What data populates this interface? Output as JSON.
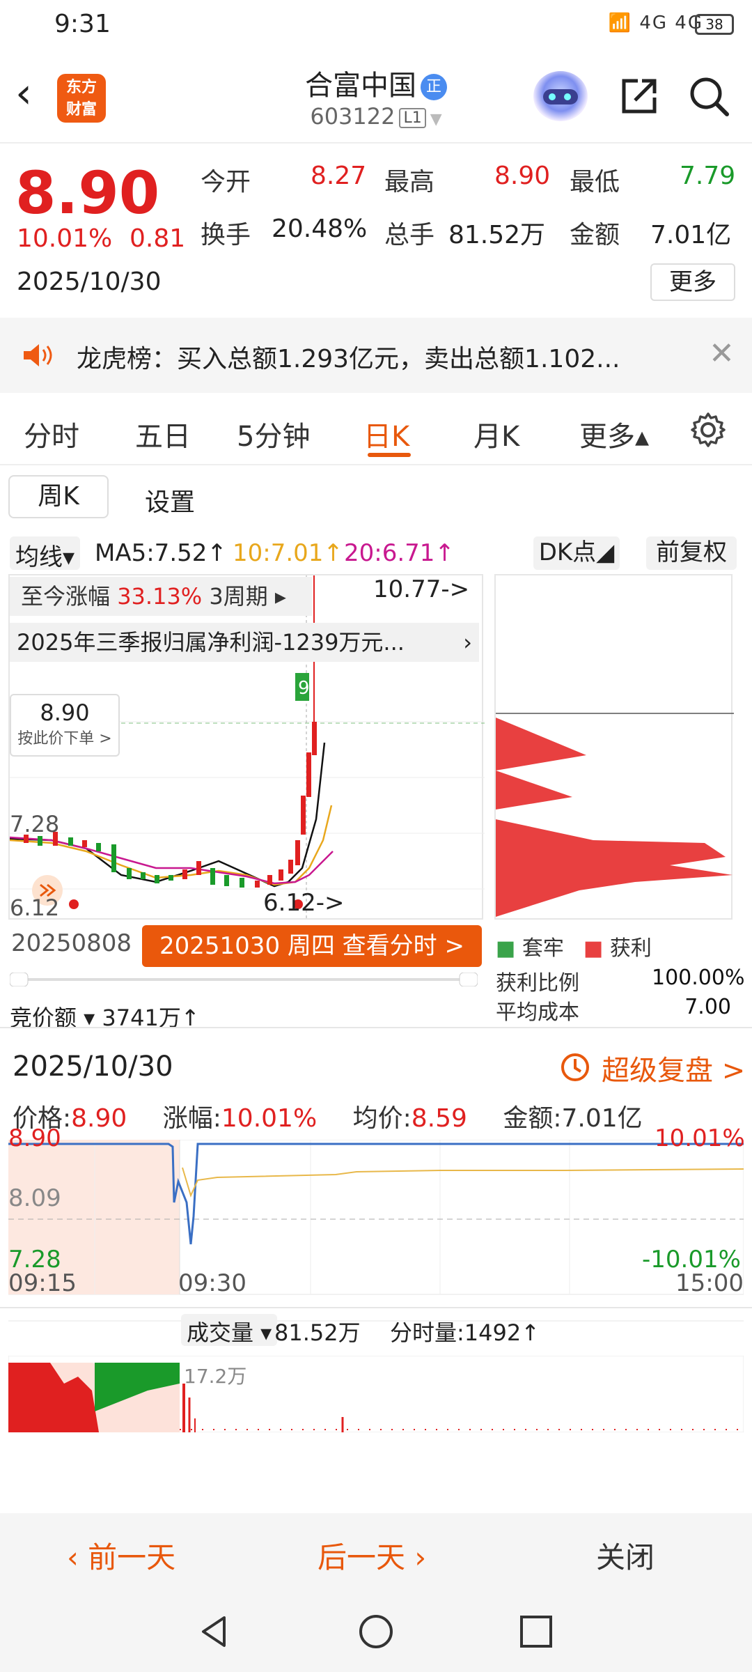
{
  "status": {
    "time": "9:31",
    "signal_icons": "📶 4G 4G",
    "battery": "38"
  },
  "header": {
    "back_icon": "‹",
    "logo_text": "东方\n财富",
    "stock_name": "合富中国",
    "corp_badge": "正",
    "code": "603122",
    "level": "L1"
  },
  "quote": {
    "price": "8.90",
    "change_pct": "10.01%",
    "change_amt": "0.81",
    "date": "2025/10/30",
    "open_label": "今开",
    "open": "8.27",
    "high_label": "最高",
    "high": "8.90",
    "low_label": "最低",
    "low": "7.79",
    "turnover_label": "换手",
    "turnover": "20.48%",
    "volume_label": "总手",
    "volume": "81.52万",
    "amount_label": "金额",
    "amount": "7.01亿",
    "more": "更多"
  },
  "news": {
    "text": "龙虎榜：买入总额1.293亿元，卖出总额1.102..."
  },
  "tabs": [
    "分时",
    "五日",
    "5分钟",
    "日K",
    "月K",
    "更多▴"
  ],
  "active_tab": "日K",
  "subtabs": {
    "week": "周K",
    "settings": "设置"
  },
  "ma": {
    "selector": "均线▾",
    "ma5": "MA5:7.52↑",
    "ma10": "10:7.01↑",
    "ma20": "20:6.71↑"
  },
  "buttons": {
    "dk": "DK点◢",
    "fq": "前复权"
  },
  "kline": {
    "gain_label": "至今涨幅",
    "gain_value": "33.13%",
    "gain_period": "3周期 ▸",
    "report": "2025年三季报归属净利润-1239万元...",
    "high_marker": "10.77->",
    "price_tag_value": "8.90",
    "price_tag_action": "按此价下单 >",
    "level_high": "7.28",
    "level_low": "6.12",
    "low_marker": "6.12->",
    "start_date": "20250808",
    "cta": "20251030 周四 查看分时 >",
    "vol_label": "竞价额 ▾ 3741万↑"
  },
  "chips": {
    "trap_label": "套牢",
    "profit_label": "获利",
    "profit_ratio_label": "获利比例",
    "profit_ratio": "100.00%",
    "avg_cost_label": "平均成本",
    "avg_cost": "7.00"
  },
  "sheet": {
    "date": "2025/10/30",
    "replay": "超级复盘 >",
    "price_label": "价格:",
    "price": "8.90",
    "pct_label": "涨幅:",
    "pct": "10.01%",
    "avg_label": "均价:",
    "avg": "8.59",
    "amount_label": "金额:",
    "amount": "7.01亿",
    "y_top": "8.90",
    "y_mid": "8.09",
    "y_bot": "7.28",
    "pct_top": "10.01%",
    "pct_bot": "-10.01%",
    "t_start": "09:15",
    "t_open": "09:30",
    "t_end": "15:00",
    "vol_sel": "成交量 ▾",
    "vol_total": "81.52万",
    "vol_label": "分时量:1492↑",
    "vol_max": "17.2万"
  },
  "footer": {
    "prev": "‹ 前一天",
    "next": "后一天 ›",
    "close": "关闭"
  },
  "colors": {
    "up": "#e02020",
    "down": "#1a9a2a",
    "accent": "#e8580c",
    "line": "#3a6fc4",
    "avg": "#e8b84a"
  }
}
